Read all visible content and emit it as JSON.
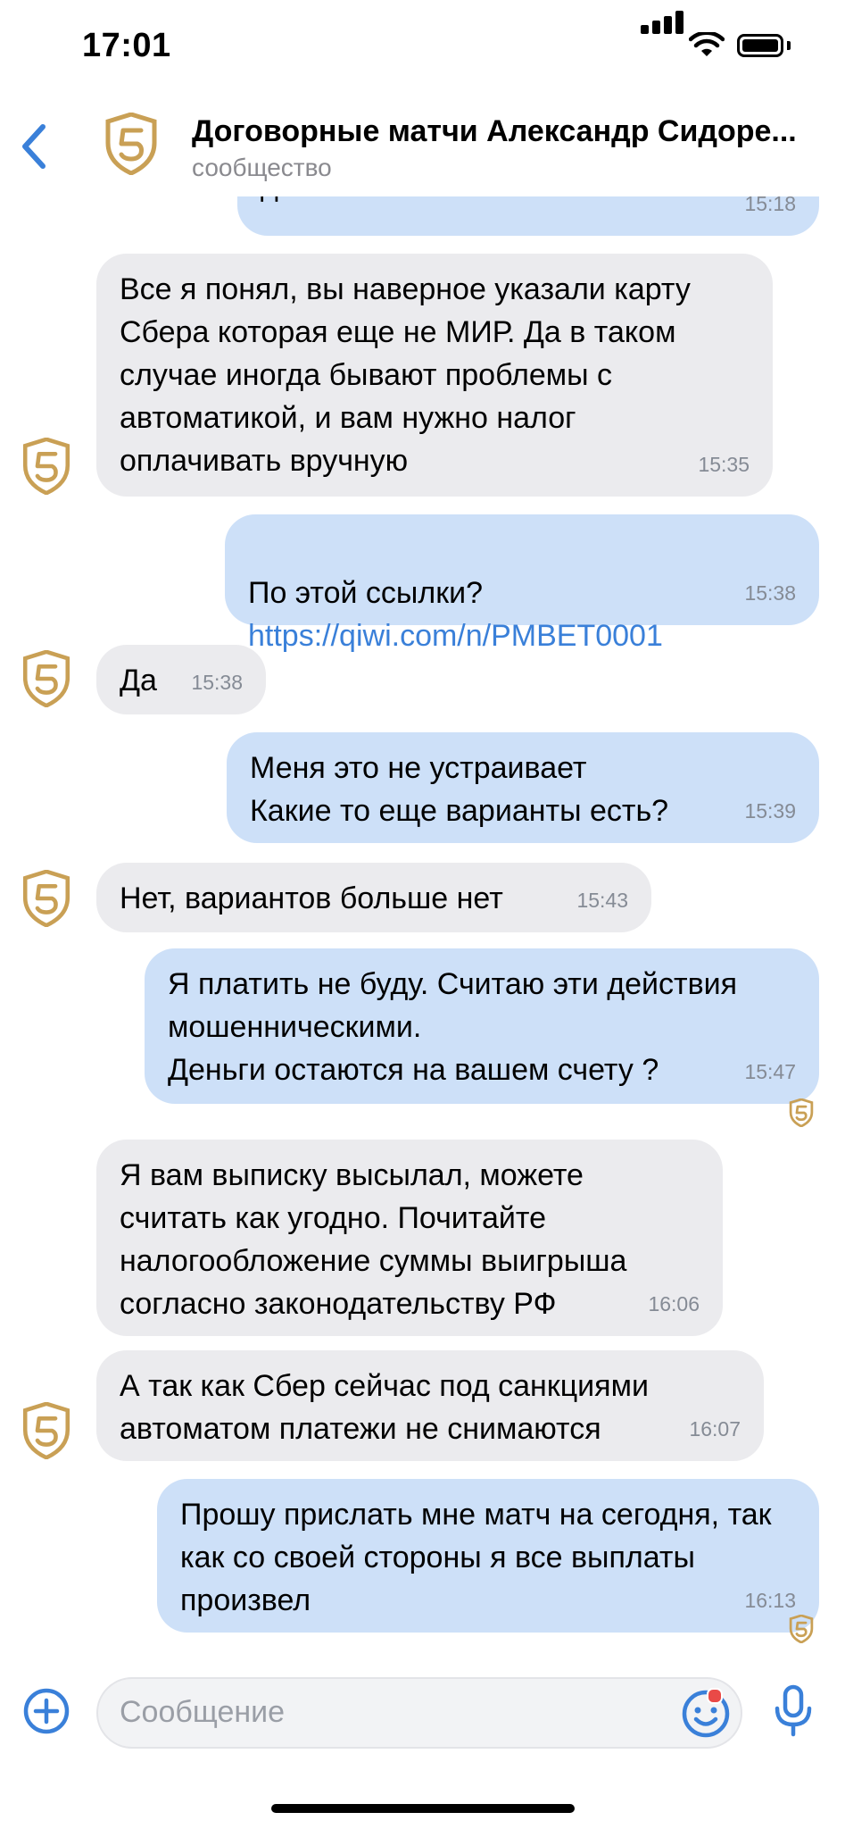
{
  "status_bar": {
    "time": "17:01"
  },
  "header": {
    "title": "Договорные матчи Александр Сидоре...",
    "subtitle": "сообщество"
  },
  "messages": [
    {
      "dir": "out",
      "text": "действия",
      "time": "15:18"
    },
    {
      "dir": "in",
      "text": "Все я понял, вы наверное указали карту Сбера которая еще не МИР. Да в таком случае иногда бывают проблемы с автоматикой, и вам нужно налог оплачивать вручную",
      "time": "15:35"
    },
    {
      "dir": "out",
      "text": "По этой ссылки?",
      "link": "https://qiwi.com/n/PMBET0001",
      "time": "15:38"
    },
    {
      "dir": "in",
      "text": "Да",
      "time": "15:38"
    },
    {
      "dir": "out",
      "text": "Меня это не устраивает\nКакие то еще варианты есть?",
      "time": "15:39"
    },
    {
      "dir": "in",
      "text": "Нет, вариантов больше нет",
      "time": "15:43"
    },
    {
      "dir": "out",
      "text": "Я платить не буду. Считаю эти действия мошенническими.\nДеньги остаются на вашем счету ?",
      "time": "15:47"
    },
    {
      "dir": "in",
      "text": "Я вам выписку высылал, можете считать как угодно. Почитайте налогообложение суммы выигрыша согласно законодательству РФ",
      "time": "16:06"
    },
    {
      "dir": "in",
      "text": "А так как Сбер сейчас под санкциями автоматом платежи не снимаются",
      "time": "16:07"
    },
    {
      "dir": "out",
      "text": "Прошу прислать мне матч на сегодня, так как со своей стороны я все выплаты произвел",
      "time": "16:13"
    }
  ],
  "composer": {
    "placeholder": "Сообщение"
  },
  "colors": {
    "accent": "#3a80d9",
    "incoming_bubble": "#ebebee",
    "outgoing_bubble": "#cde0f8",
    "logo_gold": "#c9a055"
  }
}
